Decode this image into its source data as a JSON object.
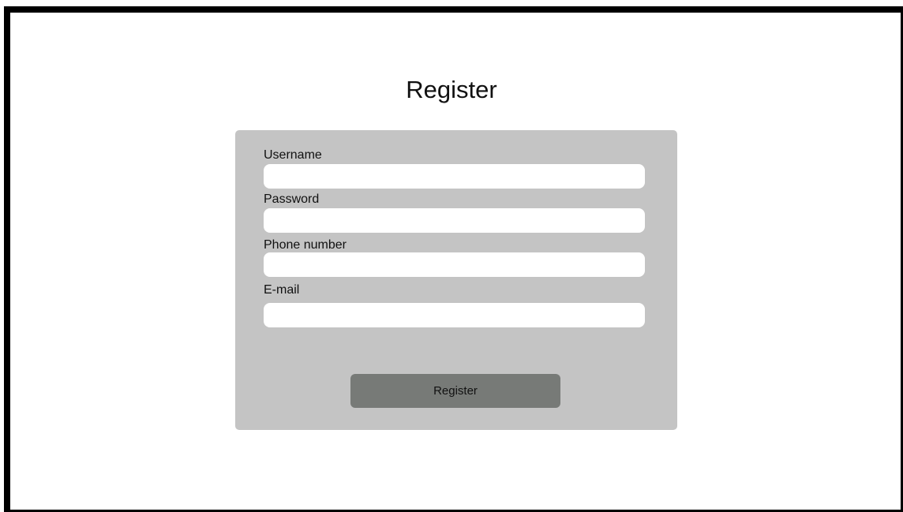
{
  "page": {
    "title": "Register"
  },
  "form": {
    "fields": [
      {
        "label": "Username",
        "value": "",
        "placeholder": ""
      },
      {
        "label": "Password",
        "value": "",
        "placeholder": ""
      },
      {
        "label": "Phone number",
        "value": "",
        "placeholder": ""
      },
      {
        "label": "E-mail",
        "value": "",
        "placeholder": ""
      }
    ],
    "submit_label": "Register"
  },
  "colors": {
    "card_background": "#c4c4c4",
    "button_background": "#777a77",
    "input_background": "#ffffff",
    "frame_border": "#000000"
  }
}
